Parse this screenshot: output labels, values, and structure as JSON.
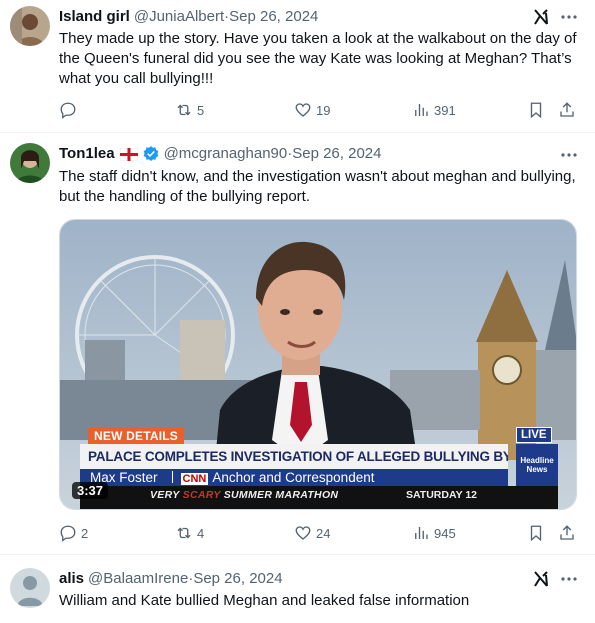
{
  "tweets": [
    {
      "name": "Island girl",
      "handle": "@JuniaAlbert",
      "sep": " · ",
      "date": "Sep 26, 2024",
      "text": "They made up the story. Have you taken a look at the walkabout on the day of the Queen's funeral did you see the way Kate was looking at Meghan? That’s what you call bullying!!!",
      "stats": {
        "replies": "",
        "reposts": "5",
        "likes": "19",
        "views": "391"
      }
    },
    {
      "name": "Ton1lea",
      "handle": "@mcgranaghan90",
      "sep": " · ",
      "date": "Sep 26, 2024",
      "verified": true,
      "text": "The staff didn't know, and the investigation wasn't about meghan and bullying, but the handling of the bullying report.",
      "stats": {
        "replies": "2",
        "reposts": "4",
        "likes": "24",
        "views": "945"
      },
      "video": {
        "duration": "3:37",
        "new_details": "NEW DETAILS",
        "headline": "PALACE COMPLETES INVESTIGATION OF ALLEGED BULLYING BY DUCHESS MEGHAN",
        "person": "Max Foster",
        "network": "CNN",
        "role": "Anchor and Correspondent",
        "live": "LIVE",
        "hln_line1": "Headline",
        "hln_line2": "News",
        "ticker_very": "VERY ",
        "ticker_scary": "SCARY",
        "ticker_rest": " SUMMER MARATHON",
        "ticker_sat": "SATURDAY 12"
      }
    },
    {
      "name": "alis",
      "handle": "@BalaamIrene",
      "sep": " · ",
      "date": "Sep 26, 2024",
      "text": "William and Kate bullied Meghan and leaked false information"
    }
  ],
  "icons": {
    "reply": "reply-icon",
    "repost": "repost-icon",
    "like": "like-icon",
    "views": "views-icon",
    "bookmark": "bookmark-icon",
    "share": "share-icon",
    "grok": "grok-icon",
    "more": "more-icon",
    "verified": "verified-badge-icon",
    "flag": "england-flag-icon"
  },
  "colors": {
    "text": "#0f1419",
    "secondary": "#536471",
    "verified": "#1d9bf0",
    "divider": "#eff3f4"
  }
}
